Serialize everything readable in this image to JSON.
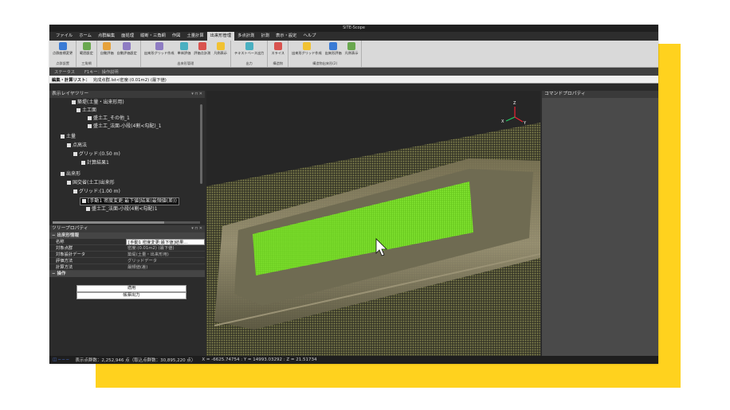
{
  "app": {
    "title": "SiTE-Scope"
  },
  "menu": [
    "ファイル",
    "ホーム",
    "点群編集",
    "面処理",
    "縦断・三角網",
    "作図",
    "土量計算",
    "出来形管理",
    "多点計測",
    "計測",
    "表示・設定",
    "ヘルプ"
  ],
  "menu_active": "出来形管理",
  "ribbon": {
    "groups": [
      {
        "label": "点群設置",
        "buttons": [
          "点群座標変更"
        ]
      },
      {
        "label": "三角網",
        "buttons": [
          "範囲設定"
        ]
      },
      {
        "label": "",
        "buttons": [
          "自動評価",
          "自動評価設定"
        ]
      },
      {
        "label": "出来形管理",
        "buttons": [
          "出来形グリッド作成",
          "単体評価",
          "評価点計測",
          "凡例表示"
        ]
      },
      {
        "label": "出力",
        "buttons": [
          "テキストベース出力"
        ]
      },
      {
        "label": "構造物",
        "buttons": [
          "スライス"
        ]
      },
      {
        "label": "構造物出来形(2)",
        "buttons": [
          "出来形グリッド作成",
          "出来形評価",
          "凡例表示"
        ]
      }
    ]
  },
  "statusbar": {
    "status_label": "ステータス",
    "fkey_label": "F1キー：操作説明"
  },
  "edit_row": {
    "label": "編集・計算リスト：",
    "value": "完成点群.lst<密度:(0.01m2) (最下値)"
  },
  "layer_tree": {
    "title": "表示レイヤツリー",
    "nodes": [
      "築堤(土量・出来形用)",
      "土工面",
      "盛土工_その他_1",
      "盛土工_法面-小段(4割<勾配)_1",
      "土量",
      "点高法",
      "グリッド:(0.50 m)",
      "計算結果1",
      "出来形",
      "国交省(土工)出来形",
      "グリッド:(1.00 m)",
      "[手動1 密度変更:最下値]結果(最頻値(差))",
      "盛土工_法面-小段(4割<勾配)1"
    ]
  },
  "properties": {
    "title": "ツリープロパティ",
    "section_info": "出来形情報",
    "rows": [
      {
        "k": "名称",
        "v": "[手動1 密度変更:最下値]結果..."
      },
      {
        "k": "対象点群",
        "v": "密度:(0.01m2) (最下値)"
      },
      {
        "k": "対象設計データ",
        "v": "築堤(土量・出来形用)"
      },
      {
        "k": "評価方法",
        "v": "グリッドデータ"
      },
      {
        "k": "計算方法",
        "v": "最頻値(差)"
      }
    ],
    "section_ops": "操作",
    "apply_button": "適用",
    "report_button": "帳票出力"
  },
  "command_panel": {
    "title": "コマンドプロパティ"
  },
  "axes": {
    "x": "X",
    "y": "Y",
    "z": "Z"
  },
  "bottom": {
    "display_points": "表示点群数：2,252,946 点（取込点群数：30,895,220 点）",
    "coords": "X = -6625.74754 : Y = 14993.03292 : Z = 21.51734"
  },
  "colors": {
    "accent_yellow": "#ffd21e",
    "field_green": "#7ee026",
    "grid_olive": "#8a8a52"
  }
}
